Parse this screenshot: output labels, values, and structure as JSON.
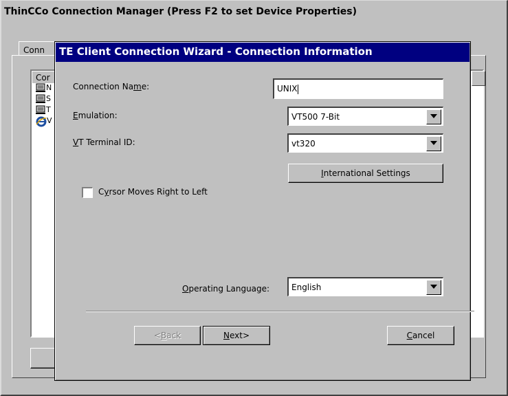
{
  "background_window": {
    "title": "ThinCCo Connection Manager (Press F2 to set Device Properties)",
    "tab_label": "Conn",
    "list_header": "Cor",
    "list_rows": [
      {
        "icon": "terminal-icon",
        "text": "N"
      },
      {
        "icon": "terminal-icon",
        "text": "S"
      },
      {
        "icon": "terminal-icon",
        "text": "T"
      },
      {
        "icon": "browser-icon",
        "text": "V"
      }
    ]
  },
  "dialog": {
    "title": "TE Client Connection Wizard - Connection Information",
    "connection_name": {
      "label_pre": "Connection Na",
      "label_u": "m",
      "label_post": "e:",
      "value": "UNIX"
    },
    "emulation": {
      "label_u": "E",
      "label_post": "mulation:",
      "value": "VT500 7-Bit"
    },
    "terminal_id": {
      "label_u": "V",
      "label_post": "T Terminal ID:",
      "value": "vt320"
    },
    "international_button": {
      "pre": "",
      "u": "I",
      "post": "nternational Settings"
    },
    "cursor_checkbox": {
      "label_pre": "C",
      "label_u": "y",
      "label_post": "rsor Moves Right to Left",
      "checked": false
    },
    "operating_language": {
      "label_u": "O",
      "label_post": "perating Language:",
      "value": "English"
    },
    "back_button": {
      "pre": "<",
      "u": "B",
      "post": "ack",
      "enabled": false
    },
    "next_button": {
      "pre": "",
      "u": "N",
      "post": "ext>"
    },
    "cancel_button": {
      "pre": "",
      "u": "C",
      "post": "ancel"
    }
  },
  "colors": {
    "title_bar": "#000080",
    "face": "#c0c0c0"
  }
}
